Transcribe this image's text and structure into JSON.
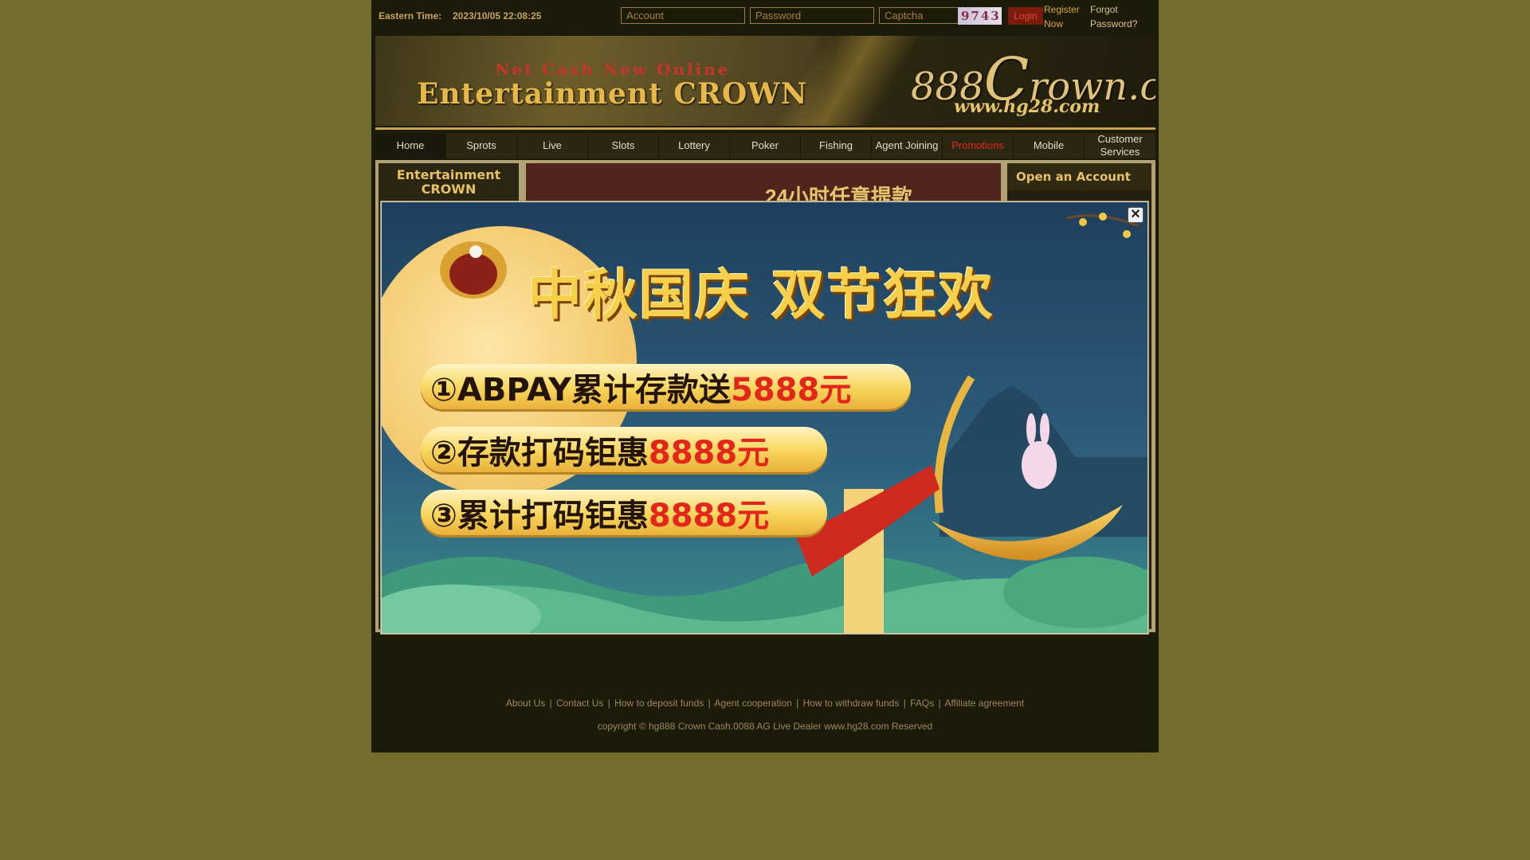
{
  "topbar": {
    "clock_label": "Eastern Time:",
    "clock_value": "2023/10/05 22:08:25",
    "account_placeholder": "Account",
    "password_placeholder": "Password",
    "captcha_placeholder": "Captcha",
    "captcha_code": "9743",
    "login_label": "Login",
    "register_label": "Register Now",
    "forgot_label": "Forgot Password?"
  },
  "banner": {
    "tagline": "Net Cash New Online",
    "title": "Entertainment CROWN",
    "logo_prefix": "888",
    "logo_initial": "C",
    "logo_suffix": "rown.com",
    "logo_url": "www.hg28.com"
  },
  "nav": {
    "items": [
      {
        "label": "Home"
      },
      {
        "label": "Sprots"
      },
      {
        "label": "Live"
      },
      {
        "label": "Slots"
      },
      {
        "label": "Lottery"
      },
      {
        "label": "Poker"
      },
      {
        "label": "Fishing"
      },
      {
        "label": "Agent Joining"
      },
      {
        "label": "Promotions"
      },
      {
        "label": "Mobile"
      },
      {
        "label": "Customer Services"
      }
    ]
  },
  "sidebar": {
    "left_title": "Entertainment CROWN",
    "right_title": "Open an Account"
  },
  "main_banner": {
    "text": "24小时任意提款"
  },
  "popup": {
    "close_symbol": "✕",
    "title": "中秋国庆 双节狂欢",
    "offers": [
      {
        "text": "①ABPAY累计存款送",
        "amount": "5888元"
      },
      {
        "text": "②存款打码钜惠",
        "amount": "8888元"
      },
      {
        "text": "③累计打码钜惠",
        "amount": "8888元"
      }
    ]
  },
  "footer": {
    "links": [
      "About Us",
      "Contact Us",
      "How to deposit funds",
      "Agent cooperation",
      "How to withdraw funds",
      "FAQs",
      "Affiliate agreement"
    ],
    "separator": "|",
    "copyright": "copyright © hg888 Crown Cash.0088 AG Live Dealer www.hg28.com Reserved"
  },
  "colors": {
    "outer_background": "#726d2f",
    "page_background": "#1c1a09",
    "gold_accent": "#c9a24b",
    "promo_red": "#e2291b",
    "popup_sky": "#2b5a7a"
  }
}
